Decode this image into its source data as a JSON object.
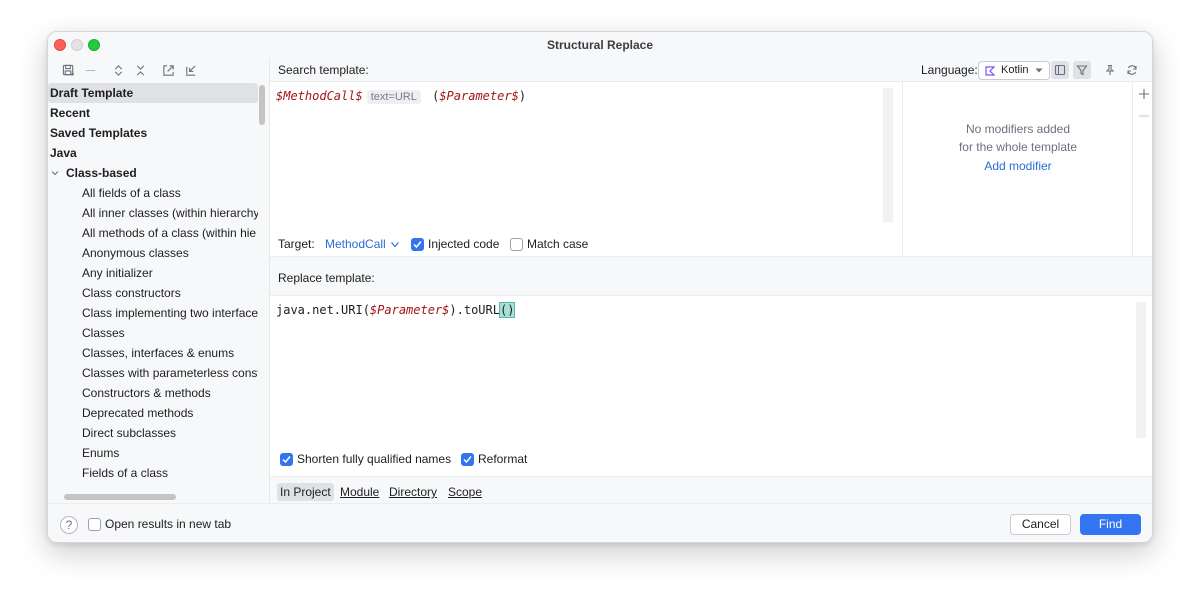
{
  "window": {
    "title": "Structural Replace"
  },
  "sidebar": {
    "items": [
      {
        "label": "Draft Template",
        "kind": "top",
        "selected": true
      },
      {
        "label": "Recent",
        "kind": "top"
      },
      {
        "label": "Saved Templates",
        "kind": "top"
      },
      {
        "label": "Java",
        "kind": "top"
      },
      {
        "label": "Class-based",
        "kind": "group"
      },
      {
        "label": "All fields of a class",
        "kind": "leaf"
      },
      {
        "label": "All inner classes (within hierarchy",
        "kind": "leaf"
      },
      {
        "label": "All methods of a class (within hie",
        "kind": "leaf"
      },
      {
        "label": "Anonymous classes",
        "kind": "leaf"
      },
      {
        "label": "Any initializer",
        "kind": "leaf"
      },
      {
        "label": "Class constructors",
        "kind": "leaf"
      },
      {
        "label": "Class implementing two interface",
        "kind": "leaf"
      },
      {
        "label": "Classes",
        "kind": "leaf"
      },
      {
        "label": "Classes, interfaces & enums",
        "kind": "leaf"
      },
      {
        "label": "Classes with parameterless const",
        "kind": "leaf"
      },
      {
        "label": "Constructors & methods",
        "kind": "leaf"
      },
      {
        "label": "Deprecated methods",
        "kind": "leaf"
      },
      {
        "label": "Direct subclasses",
        "kind": "leaf"
      },
      {
        "label": "Enums",
        "kind": "leaf"
      },
      {
        "label": "Fields of a class",
        "kind": "leaf"
      }
    ]
  },
  "search": {
    "label": "Search template:",
    "code": {
      "var1": "$MethodCall$",
      "hint": "text=URL",
      "paren_open": " (",
      "var2": "$Parameter$",
      "paren_close": ")"
    }
  },
  "language": {
    "label": "Language:",
    "value": "Kotlin"
  },
  "modifiers": {
    "line1": "No modifiers added",
    "line2": "for the whole template",
    "link": "Add modifier"
  },
  "target": {
    "label": "Target:",
    "value": "MethodCall",
    "injected_label": "Injected code",
    "injected_checked": true,
    "match_case_label": "Match case",
    "match_case_checked": false
  },
  "replace": {
    "label": "Replace template:",
    "code": {
      "prefix": "java.net.URI(",
      "var": "$Parameter$",
      "middle": ").toURL",
      "brackets": "()"
    },
    "shorten_label": "Shorten fully qualified names",
    "shorten_checked": true,
    "reformat_label": "Reformat",
    "reformat_checked": true
  },
  "scope": {
    "tabs": [
      {
        "label": "In Project",
        "active": true
      },
      {
        "label": "Module"
      },
      {
        "label": "Directory"
      },
      {
        "label": "Scope"
      }
    ]
  },
  "footer": {
    "help": "?",
    "open_new_tab_label": "Open results in new tab",
    "open_new_tab_checked": false,
    "cancel": "Cancel",
    "find": "Find"
  },
  "colors": {
    "accent": "#3574f0",
    "link": "#2a6bd6",
    "kotlin_var": "#a31515"
  }
}
